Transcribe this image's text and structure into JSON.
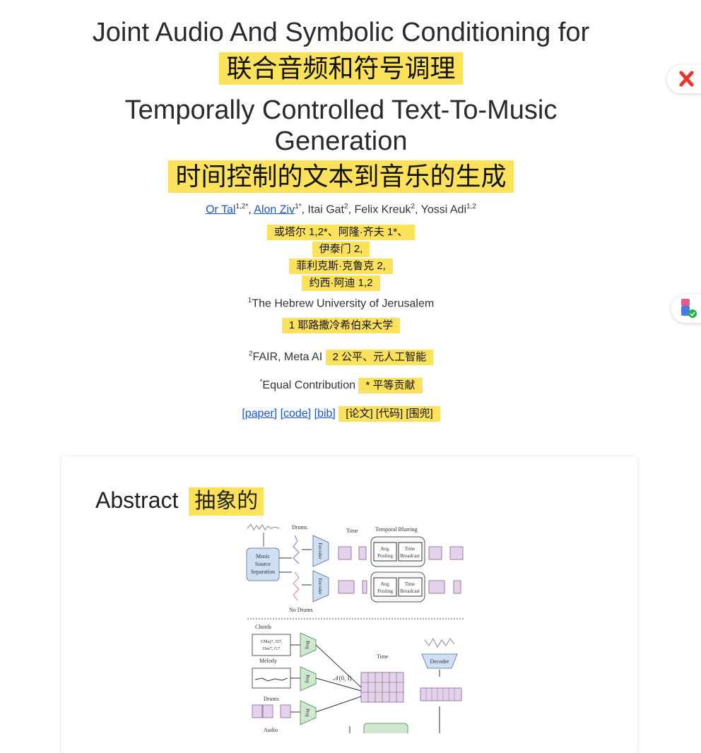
{
  "title": {
    "line1_en": "Joint Audio And Symbolic Conditioning for",
    "line1_zh": "联合音频和符号调理",
    "line2_en": "Temporally Controlled Text-To-Music",
    "line3_en": "Generation",
    "line2_zh": "时间控制的文本到音乐的生成"
  },
  "authors": {
    "a1": "Or Tal",
    "a1_sup": "1,2*",
    "a2": "Alon Ziv",
    "a2_sup": "1*",
    "a3": "Itai Gat",
    "a3_sup": "2",
    "a4": "Felix Kreuk",
    "a4_sup": "2",
    "a5": "Yossi Adi",
    "a5_sup": "1,2",
    "zh_1": "或塔尔 1,2*、阿隆·齐夫 1*、",
    "zh_2": "伊泰门 2,",
    "zh_3": "菲利克斯·克鲁克 2,",
    "zh_4": "约西·阿迪 1,2"
  },
  "affiliations": {
    "aff1_sup": "1",
    "aff1": "The Hebrew University of Jerusalem",
    "aff1_zh": "1 耶路撒冷希伯来大学",
    "aff2_sup": "2",
    "aff2": "FAIR, Meta AI",
    "aff2_zh": "2 公平、元人工智能",
    "equal_sup": "*",
    "equal": "Equal Contribution",
    "equal_zh": "* 平等贡献"
  },
  "links": {
    "paper": "[paper]",
    "code": "[code]",
    "bib": "[bib]",
    "zh": "[论文] [代码] [围兜]"
  },
  "abstract": {
    "title": "Abstract",
    "title_zh": "抽象的"
  },
  "diagram": {
    "drums": "Drums",
    "no_drums": "No Drums",
    "time": "Time",
    "temporal_blurring": "Temporal Blurring",
    "music": "Music",
    "source": "Source",
    "separation": "Separation",
    "encoder": "Encoder",
    "avg": "Avg.",
    "pooling": "Pooling",
    "time_b": "Time",
    "broadcast": "Broadcast",
    "chords": "Chords",
    "chord_seq1": "CMaj7, D7,",
    "chord_seq2": "Dm7, G7",
    "melody": "Melody",
    "drums2": "Drums",
    "audio": "Audio",
    "proj": "Proj",
    "noise": "𝒩(0, I)",
    "time2": "Time",
    "decoder": "Decoder",
    "dots": "..."
  },
  "colors": {
    "highlight": "#fce15a",
    "link": "#1a56d6",
    "encoder_fill": "#cfe0f5",
    "proj_fill": "#cfe8cf",
    "token_fill": "#e3d2ea",
    "close_icon": "#e8362a"
  },
  "icons": {
    "close": "close-x-icon",
    "extension": "extension-icon"
  }
}
